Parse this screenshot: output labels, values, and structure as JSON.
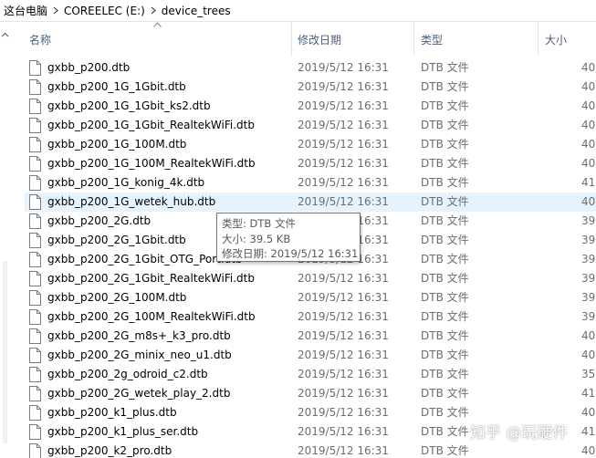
{
  "breadcrumb": {
    "items": [
      "这台电脑",
      "COREELEC (E:)",
      "device_trees"
    ]
  },
  "columns": {
    "name": "名称",
    "date": "修改日期",
    "type": "类型",
    "size": "大小"
  },
  "files": [
    {
      "name": "gxbb_p200.dtb",
      "date": "2019/5/12 16:31",
      "type": "DTB 文件",
      "size": "40"
    },
    {
      "name": "gxbb_p200_1G_1Gbit.dtb",
      "date": "2019/5/12 16:31",
      "type": "DTB 文件",
      "size": "40"
    },
    {
      "name": "gxbb_p200_1G_1Gbit_ks2.dtb",
      "date": "2019/5/12 16:31",
      "type": "DTB 文件",
      "size": "40"
    },
    {
      "name": "gxbb_p200_1G_1Gbit_RealtekWiFi.dtb",
      "date": "2019/5/12 16:31",
      "type": "DTB 文件",
      "size": "40"
    },
    {
      "name": "gxbb_p200_1G_100M.dtb",
      "date": "2019/5/12 16:31",
      "type": "DTB 文件",
      "size": "40"
    },
    {
      "name": "gxbb_p200_1G_100M_RealtekWiFi.dtb",
      "date": "2019/5/12 16:31",
      "type": "DTB 文件",
      "size": "40"
    },
    {
      "name": "gxbb_p200_1G_konig_4k.dtb",
      "date": "2019/5/12 16:31",
      "type": "DTB 文件",
      "size": "41"
    },
    {
      "name": "gxbb_p200_1G_wetek_hub.dtb",
      "date": "2019/5/12 16:31",
      "type": "DTB 文件",
      "size": "40"
    },
    {
      "name": "gxbb_p200_2G.dtb",
      "date": "2019/5/12 16:31",
      "type": "DTB 文件",
      "size": "39"
    },
    {
      "name": "gxbb_p200_2G_1Gbit.dtb",
      "date": "2019/5/12 16:31",
      "type": "DTB 文件",
      "size": "39"
    },
    {
      "name": "gxbb_p200_2G_1Gbit_OTG_Port.dtb",
      "date": "2019/5/12 16:31",
      "type": "DTB 文件",
      "size": "39"
    },
    {
      "name": "gxbb_p200_2G_1Gbit_RealtekWiFi.dtb",
      "date": "2019/5/12 16:31",
      "type": "DTB 文件",
      "size": "39"
    },
    {
      "name": "gxbb_p200_2G_100M.dtb",
      "date": "2019/5/12 16:31",
      "type": "DTB 文件",
      "size": "39"
    },
    {
      "name": "gxbb_p200_2G_100M_RealtekWiFi.dtb",
      "date": "2019/5/12 16:31",
      "type": "DTB 文件",
      "size": "39"
    },
    {
      "name": "gxbb_p200_2G_m8s+_k3_pro.dtb",
      "date": "2019/5/12 16:31",
      "type": "DTB 文件",
      "size": "40"
    },
    {
      "name": "gxbb_p200_2G_minix_neo_u1.dtb",
      "date": "2019/5/12 16:31",
      "type": "DTB 文件",
      "size": "40"
    },
    {
      "name": "gxbb_p200_2g_odroid_c2.dtb",
      "date": "2019/5/12 16:31",
      "type": "DTB 文件",
      "size": "35"
    },
    {
      "name": "gxbb_p200_2G_wetek_play_2.dtb",
      "date": "2019/5/12 16:31",
      "type": "DTB 文件",
      "size": "41"
    },
    {
      "name": "gxbb_p200_k1_plus.dtb",
      "date": "2019/5/12 16:31",
      "type": "DTB 文件",
      "size": "40"
    },
    {
      "name": "gxbb_p200_k1_plus_ser.dtb",
      "date": "2019/5/12 16:31",
      "type": "DTB 文件",
      "size": "41"
    },
    {
      "name": "gxbb_p200_k2_pro.dtb",
      "date": "2019/5/12 16:31",
      "type": "DTB 文件",
      "size": "40"
    }
  ],
  "hovered_index": 7,
  "tooltip": {
    "type_line": "类型: DTB 文件",
    "size_line": "大小: 39.5 KB",
    "date_line": "修改日期: 2019/5/12 16:31"
  },
  "watermark": "知乎 @玩硬件",
  "colors": {
    "hover_row": "#e5f3ff",
    "header_text": "#4c607a",
    "secondary_text": "#6d6d6d"
  },
  "icons": {
    "file": "document-icon",
    "breadcrumb_separator": "chevron-right-icon",
    "sort": "sort-up-icon"
  }
}
